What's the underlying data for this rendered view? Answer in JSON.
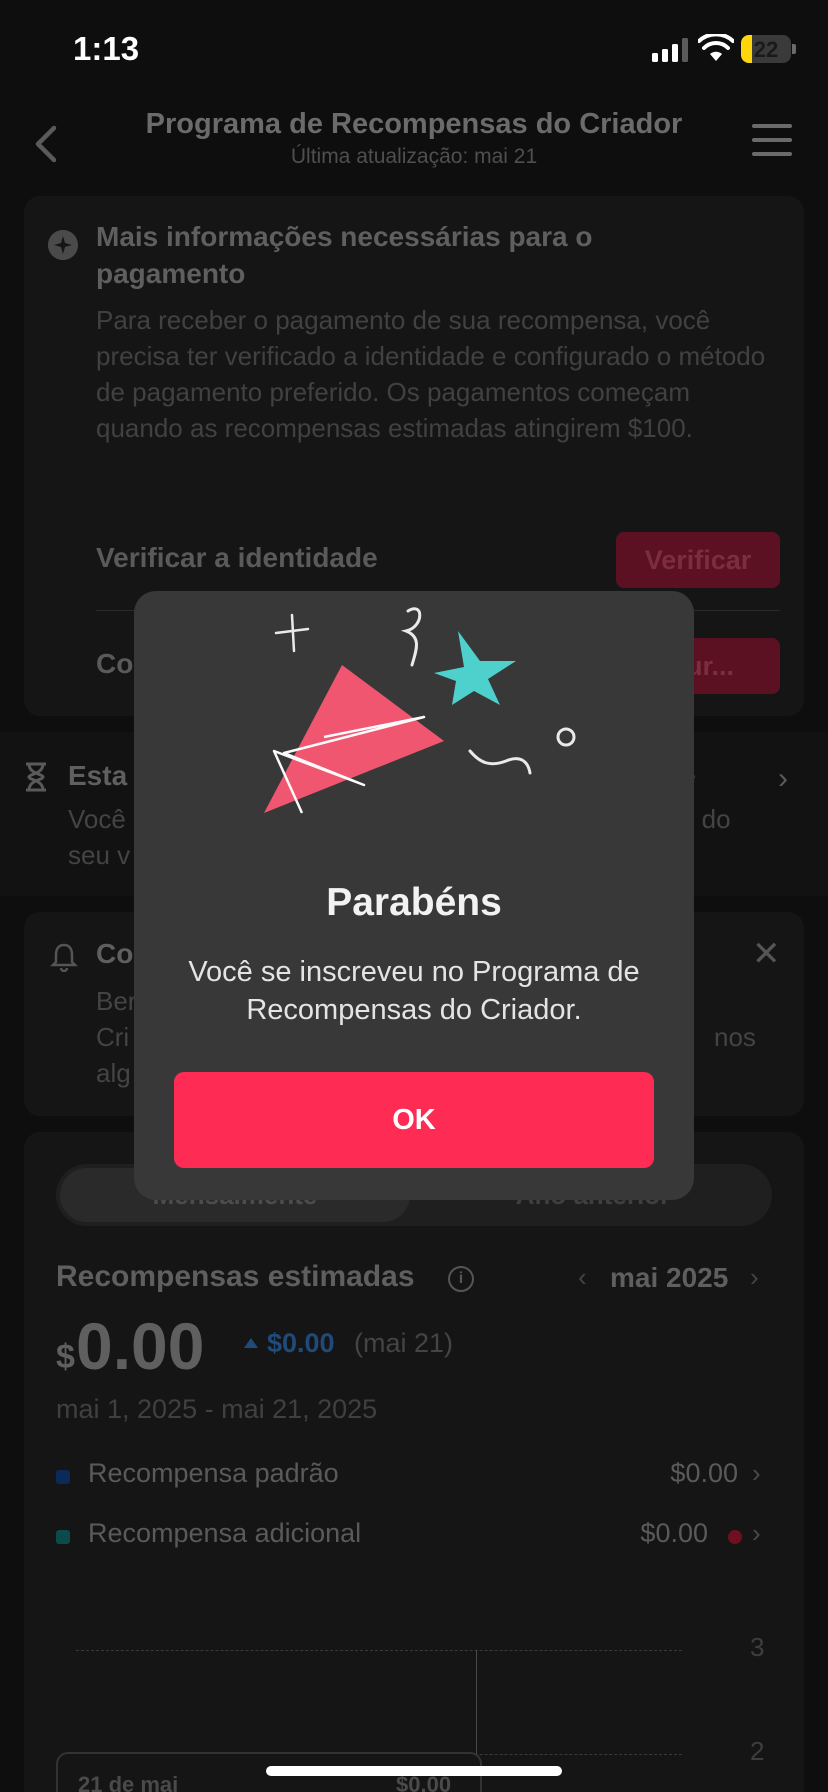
{
  "status_bar": {
    "time": "1:13",
    "battery": "22"
  },
  "header": {
    "title": "Programa de Recompensas do Criador",
    "subtitle": "Última atualização: mai 21"
  },
  "payment_card": {
    "title": "Mais informações necessárias para o pagamento",
    "body": "Para receber o pagamento de sua recompensa, você precisa ter verificado a identidade e configurado o método de pagamento preferido. Os pagamentos começam quando as recompensas estimadas atingirem $100.",
    "row1_label": "Verificar a identidade",
    "row1_button": "Verificar",
    "row2_label": "Co",
    "row2_button": "igur..."
  },
  "banner": {
    "title_left": "Esta",
    "title_right": "e",
    "line1_left": "Você",
    "line1_right": "o do",
    "line2": "seu v"
  },
  "notice_card": {
    "title": "Co",
    "line1": "Ber",
    "line2": "Cri",
    "line2_right": "nos",
    "line3": "alg"
  },
  "rewards": {
    "tab_monthly": "Mensalmente",
    "tab_previous": "Ano anterior",
    "title": "Recompensas estimadas",
    "month": "mai 2025",
    "currency": "$",
    "amount": "0.00",
    "delta": "$0.00",
    "delta_date": "(mai 21)",
    "date_range": "mai 1, 2025 - mai 21, 2025",
    "legend": [
      {
        "label": "Recompensa padrão",
        "value": "$0.00",
        "color": "#0a2a5a"
      },
      {
        "label": "Recompensa adicional",
        "value": "$0.00",
        "color": "#0d4a4a"
      }
    ],
    "y_ticks": [
      "3",
      "2"
    ],
    "tooltip_date": "21 de mai",
    "tooltip_value": "$0.00"
  },
  "modal": {
    "title": "Parabéns",
    "message": "Você se inscreveu no Programa de Recompensas do Criador.",
    "ok_label": "OK",
    "accent": "#fe2c55"
  }
}
